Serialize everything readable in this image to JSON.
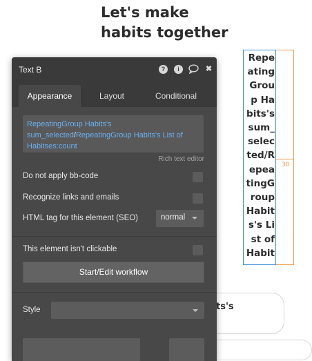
{
  "canvas": {
    "headline_line1": "Let's make",
    "headline_line2": "habits together",
    "selected_text": "RepeatingGroup Habits's sum_selected/RepeatingGroup Habits's List of Habitses:count",
    "dimension_label": "30",
    "card_text": "ts's"
  },
  "panel": {
    "title": "Text B",
    "icons": [
      "help-icon",
      "info-icon",
      "comment-icon",
      "close-icon"
    ],
    "help_glyph": "?",
    "info_glyph": "i",
    "close_glyph": "✖",
    "tabs": [
      "Appearance",
      "Layout",
      "Conditional"
    ],
    "active_tab": "Appearance",
    "expression": {
      "part1": " RepeatingGroup Habits's sum_selected",
      "separator": "/",
      "part2": "RepeatingGroup Habits's List of Habitses:count"
    },
    "rich_text_editor_label": "Rich text editor",
    "options": {
      "no_bbcode": "Do not apply bb-code",
      "recognize_links": "Recognize links and emails",
      "html_tag_label": "HTML tag for this element (SEO)",
      "html_tag_value": "normal",
      "not_clickable": "This element isn't clickable"
    },
    "workflow_button": "Start/Edit workflow",
    "style_label": "Style",
    "style_value": ""
  }
}
